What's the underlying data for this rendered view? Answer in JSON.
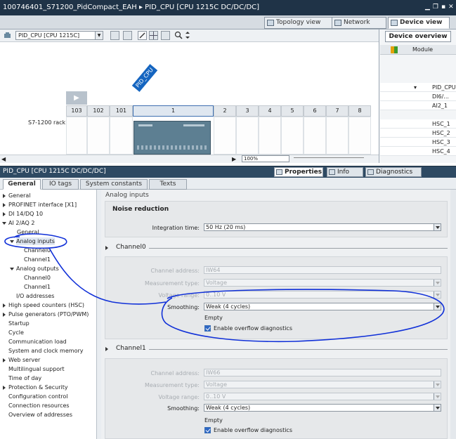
{
  "titlebar": {
    "path": "100746401_S71200_PidCompact_EAH ▸ PID_CPU [CPU 1215C DC/DC/DC]",
    "controls": [
      "▁",
      "❐",
      "▪",
      "✕"
    ]
  },
  "view_tabs": {
    "topology": "Topology view",
    "network": "Network view",
    "device": "Device view"
  },
  "device_select": "PID_CPU [CPU 1215C]",
  "canvas": {
    "rack_label": "S7-1200 rack",
    "cpu_tag": "PID_CPU",
    "slots": [
      "103",
      "102",
      "101",
      "1",
      "2",
      "3",
      "4",
      "5",
      "6",
      "7",
      "8"
    ],
    "zoom": "100%"
  },
  "overview": {
    "tab": "Device overview",
    "col_module": "Module",
    "rows": [
      "PID_CPU",
      "DI6/...",
      "AI2_1",
      "HSC_1",
      "HSC_2",
      "HSC_3",
      "HSC_4"
    ]
  },
  "properties": {
    "title": "PID_CPU [CPU 1215C DC/DC/DC]",
    "tabs": {
      "properties": "Properties",
      "info": "Info",
      "diagnostics": "Diagnostics"
    }
  },
  "inner_tabs": [
    "General",
    "IO tags",
    "System constants",
    "Texts"
  ],
  "nav": {
    "general": "General",
    "profinet": "PROFINET interface [X1]",
    "di": "DI 14/DQ 10",
    "ai": "AI 2/AQ 2",
    "ai_general": "General",
    "analog_inputs": "Analog inputs",
    "ch0": "Channel0",
    "ch1": "Channel1",
    "analog_outputs": "Analog outputs",
    "ao_ch0": "Channel0",
    "ao_ch1": "Channel1",
    "io_addresses": "I/O addresses",
    "hsc": "High speed counters (HSC)",
    "pto": "Pulse generators (PTO/PWM)",
    "startup": "Startup",
    "cycle": "Cycle",
    "comm_load": "Communication load",
    "sys_clock": "System and clock memory",
    "web": "Web server",
    "multilingual": "Multilingual support",
    "time": "Time of day",
    "protection": "Protection & Security",
    "config_control": "Configuration control",
    "conn_resources": "Connection resources",
    "overview_addr": "Overview of addresses"
  },
  "content": {
    "section_title": "Analog inputs",
    "noise": {
      "title": "Noise reduction",
      "label": "Integration time:",
      "value": "50 Hz (20 ms)"
    },
    "channel0": {
      "title": "Channel0",
      "address_label": "Channel address:",
      "address": "IW64",
      "mtype_label": "Measurement type:",
      "mtype": "Voltage",
      "vrange_label": "Voltage range:",
      "vrange": "0..10 V",
      "smoothing_label": "Smoothing:",
      "smoothing": "Weak (4 cycles)",
      "empty": "Empty",
      "overflow": "Enable overflow diagnostics"
    },
    "channel1": {
      "title": "Channel1",
      "address_label": "Channel address:",
      "address": "IW66",
      "mtype_label": "Measurement type:",
      "mtype": "Voltage",
      "vrange_label": "Voltage range:",
      "vrange": "0..10 V",
      "smoothing_label": "Smoothing:",
      "smoothing": "Weak (4 cycles)",
      "empty": "Empty",
      "overflow": "Enable overflow diagnostics"
    }
  },
  "colors": {
    "titlebar": "#1f3347",
    "accent": "#1565c0",
    "annotation": "#1030d8",
    "cpu": "#5d7f92"
  }
}
